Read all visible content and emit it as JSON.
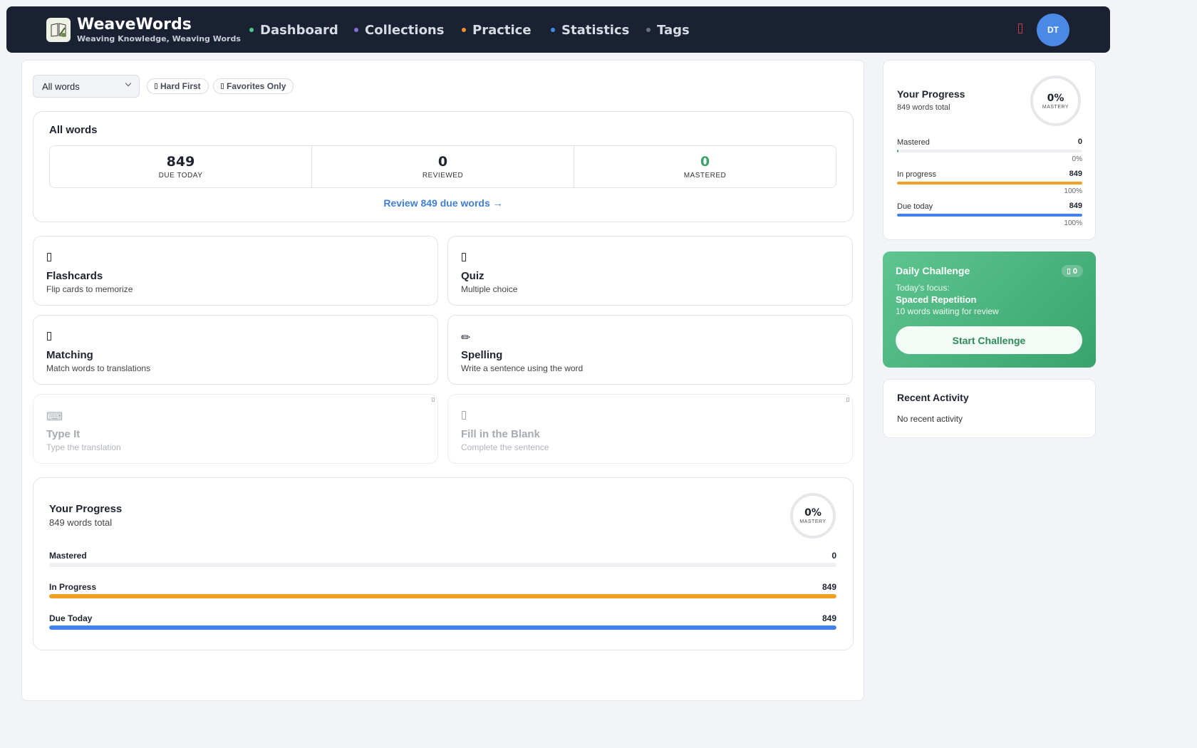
{
  "brand": {
    "title": "WeaveWords",
    "subtitle": "Weaving Knowledge, Weaving Words"
  },
  "nav": [
    {
      "label": "Dashboard",
      "dot_color": "#4fc78c"
    },
    {
      "label": "Collections",
      "dot_color": "#8a6ee0"
    },
    {
      "label": "Practice",
      "dot_color": "#f0922e"
    },
    {
      "label": "Statistics",
      "dot_color": "#3f8ae8"
    },
    {
      "label": "Tags",
      "dot_color": "#6c7280"
    }
  ],
  "user": {
    "initials": "DT"
  },
  "filters": {
    "select_value": "All words",
    "hard_first": "Hard First",
    "favorites_only": "Favorites Only"
  },
  "summary": {
    "title": "All words",
    "stats": [
      {
        "value": "849",
        "label": "DUE TODAY",
        "color": "#1f2430"
      },
      {
        "value": "0",
        "label": "REVIEWED",
        "color": "#1f2430"
      },
      {
        "value": "0",
        "label": "MASTERED",
        "color": "#3fa36b"
      }
    ],
    "review_link": "Review 849 due words →"
  },
  "modes": [
    {
      "title": "Flashcards",
      "desc": "Flip cards to memorize",
      "icon": "cards-icon",
      "enabled": true
    },
    {
      "title": "Quiz",
      "desc": "Multiple choice",
      "icon": "quiz-icon",
      "enabled": true
    },
    {
      "title": "Matching",
      "desc": "Match words to translations",
      "icon": "matching-icon",
      "enabled": true
    },
    {
      "title": "Spelling",
      "desc": "Write a sentence using the word",
      "icon": "pencil-icon",
      "enabled": true
    },
    {
      "title": "Type It",
      "desc": "Type the translation",
      "icon": "keyboard-icon",
      "enabled": false
    },
    {
      "title": "Fill in the Blank",
      "desc": "Complete the sentence",
      "icon": "blank-icon",
      "enabled": false
    }
  ],
  "progress_main": {
    "title": "Your Progress",
    "subtitle": "849 words total",
    "mastery_pct": "0%",
    "mastery_label": "MASTERY",
    "rows": [
      {
        "label": "Mastered",
        "value": "0",
        "fraction": 0,
        "color": "#e6e9ee"
      },
      {
        "label": "In Progress",
        "value": "849",
        "fraction": 1,
        "color": "#f0a024"
      },
      {
        "label": "Due Today",
        "value": "849",
        "fraction": 1,
        "color": "#3f82e8"
      }
    ]
  },
  "progress_side": {
    "title": "Your Progress",
    "subtitle": "849 words total",
    "mastery_pct": "0%",
    "mastery_label": "MASTERY",
    "rows": [
      {
        "label": "Mastered",
        "value": "0",
        "pct": "0%",
        "fraction": 0.004,
        "color": "#3fa36b"
      },
      {
        "label": "In progress",
        "value": "849",
        "pct": "100%",
        "fraction": 1,
        "color": "#f0a024"
      },
      {
        "label": "Due today",
        "value": "849",
        "pct": "100%",
        "fraction": 1,
        "color": "#3f82e8"
      }
    ]
  },
  "challenge": {
    "title": "Daily Challenge",
    "badge": "0",
    "focus_label": "Today's focus:",
    "topic": "Spaced Repetition",
    "count_text": "10 words waiting for review",
    "button": "Start Challenge"
  },
  "activity": {
    "title": "Recent Activity",
    "empty": "No recent activity"
  }
}
